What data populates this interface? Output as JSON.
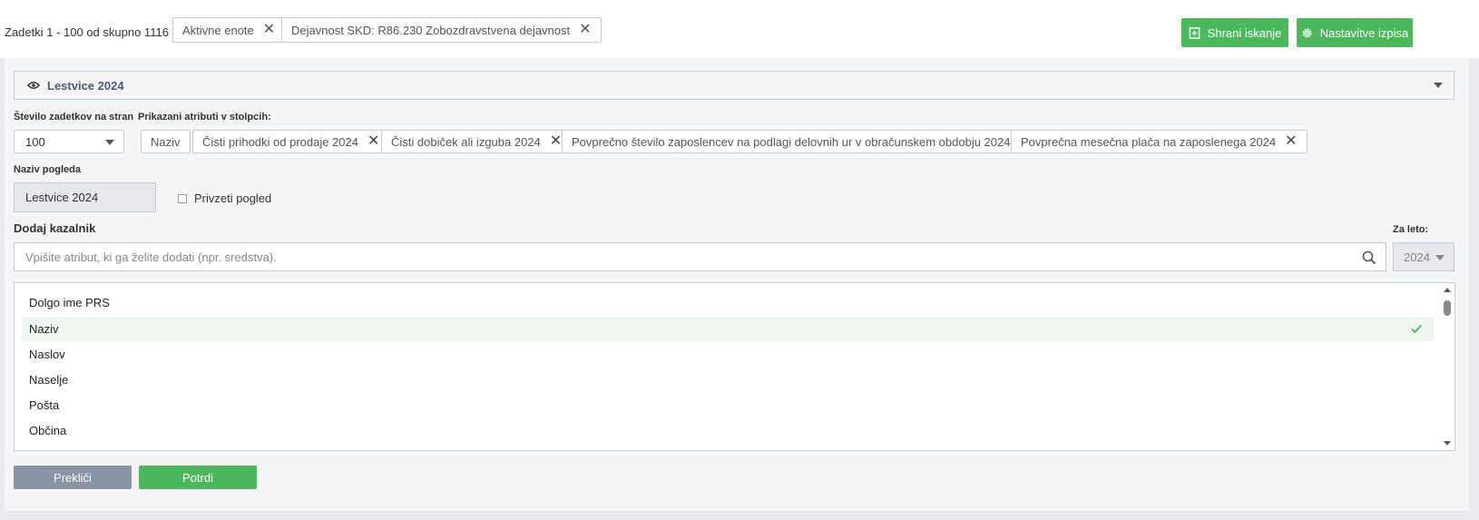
{
  "header": {
    "result_count": "Zadetki 1 - 100 od skupno 1116",
    "filters": [
      {
        "label": "Aktivne enote"
      },
      {
        "label": "Dejavnost SKD: R86.230 Zobozdravstvena dejavnost"
      }
    ],
    "save_search_label": "Shrani iskanje",
    "output_settings_label": "Nastavitve izpisa"
  },
  "view": {
    "title": "Lestvice 2024"
  },
  "records_per_page": {
    "label": "Število zadetkov na stran",
    "value": "100"
  },
  "shown_attributes": {
    "label": "Prikazani atributi v stolpcih:",
    "items": [
      {
        "label": "Naziv",
        "removable": false
      },
      {
        "label": "Čisti prihodki od prodaje 2024",
        "removable": true
      },
      {
        "label": "Čisti dobiček ali izguba 2024",
        "removable": true
      },
      {
        "label": "Povprečno število zaposlencev na podlagi delovnih ur v obračunskem obdobju 2024",
        "removable": true
      },
      {
        "label": "Povprečna mesečna plača na zaposlenega 2024",
        "removable": true
      }
    ]
  },
  "view_name": {
    "label": "Naziv pogleda",
    "value": "Lestvice 2024",
    "default_view_label": "Privzeti pogled"
  },
  "add_indicator": {
    "heading": "Dodaj kazalnik",
    "search_placeholder": "Vpišite atribut, ki ga želite dodati (npr. sredstva).",
    "year_label": "Za leto:",
    "year_value": "2024"
  },
  "attribute_list": [
    {
      "label": "Dolgo ime PRS",
      "selected": false
    },
    {
      "label": "Naziv",
      "selected": true
    },
    {
      "label": "Naslov",
      "selected": false
    },
    {
      "label": "Naselje",
      "selected": false
    },
    {
      "label": "Pošta",
      "selected": false
    },
    {
      "label": "Občina",
      "selected": false
    }
  ],
  "actions": {
    "cancel_label": "Prekliči",
    "confirm_label": "Potrdi"
  },
  "colors": {
    "green": "#4cb85c",
    "grey_button": "#8a94a3"
  }
}
